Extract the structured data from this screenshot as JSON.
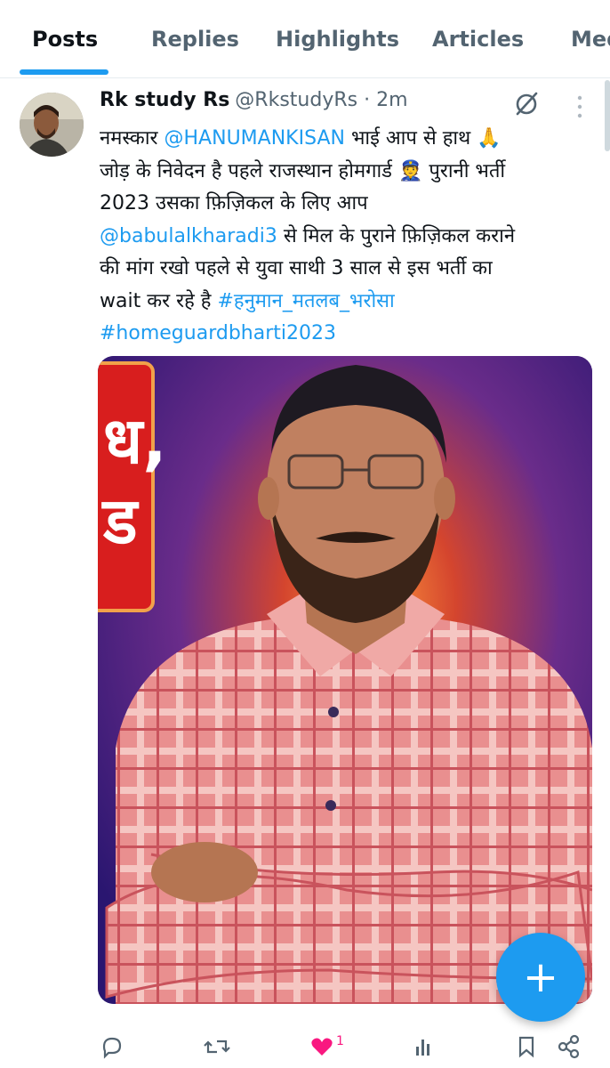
{
  "tabs": [
    {
      "label": "Posts",
      "active": true
    },
    {
      "label": "Replies",
      "active": false
    },
    {
      "label": "Highlights",
      "active": false
    },
    {
      "label": "Articles",
      "active": false
    },
    {
      "label": "Media",
      "active": false
    }
  ],
  "tweet": {
    "author_name": "Rk study Rs",
    "author_handle": "@RkstudyRs",
    "separator": "·",
    "time": "2m",
    "lines": [
      {
        "pre": "नमस्कार ",
        "mention": "@HANUMANKISAN",
        "post": " भाई आप से हाथ 🙏"
      },
      {
        "text": "जोड़ के निवेदन है पहले राजस्थान होमगार्ड 👮 पुरानी भर्ती"
      },
      {
        "text": "2023 उसका फ़िज़िकल के लिए आप"
      },
      {
        "mention": "@babulalkharadi3",
        "post": "  से मिल के पुराने फ़िज़िकल कराने"
      },
      {
        "text": "की मांग रखो पहले से युवा साथी 3 साल से इस भर्ती का"
      },
      {
        "pre": "wait कर रहे है ",
        "hashtag": "#हनुमान_मतलब_भरोसा"
      },
      {
        "hashtag": "#homeguardbharti2023"
      }
    ],
    "media_overlay_text": [
      "ध,",
      "ड"
    ],
    "like_count": "1"
  },
  "icons": {
    "grok": "grok-slash-circle-icon",
    "more": "more-vertical-icon",
    "compose": "plus-icon",
    "reply": "reply-icon",
    "repost": "repost-icon",
    "like": "heart-icon",
    "views": "views-icon",
    "bookmark": "bookmark-icon",
    "share": "share-icon"
  },
  "fab_label": "+",
  "colors": {
    "accent": "#1d9bf0",
    "like": "#f91880",
    "muted": "#536471"
  }
}
